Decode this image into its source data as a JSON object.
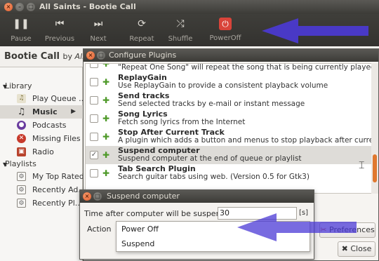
{
  "main_window": {
    "title": "All Saints - Bootie Call",
    "controls": {
      "close": "×",
      "minimize": "–",
      "maximize": "□"
    }
  },
  "toolbar": {
    "pause": {
      "label": "Pause",
      "glyph": "❚❚"
    },
    "previous": {
      "label": "Previous",
      "glyph": "⏮"
    },
    "next": {
      "label": "Next",
      "glyph": "⏭"
    },
    "repeat": {
      "label": "Repeat",
      "glyph": "⟳"
    },
    "shuffle": {
      "label": "Shuffle",
      "glyph": "⤮"
    },
    "poweroff": {
      "label": "PowerOff",
      "glyph": "⏻"
    }
  },
  "now_playing": {
    "title": "Bootie Call",
    "by": "by",
    "artist": "All Sa"
  },
  "sidebar": {
    "library_heading": "Library",
    "library_items": [
      {
        "label": "Play Queue ...",
        "icon": "queue-icon"
      },
      {
        "label": "Music",
        "icon": "music-note-icon",
        "chevron": "▶"
      },
      {
        "label": "Podcasts",
        "icon": "podcast-icon"
      },
      {
        "label": "Missing Files",
        "icon": "missing-files-icon"
      },
      {
        "label": "Radio",
        "icon": "radio-icon"
      }
    ],
    "playlists_heading": "Playlists",
    "playlist_items": [
      {
        "label": "My Top Rated",
        "icon": "smart-playlist-icon"
      },
      {
        "label": "Recently Ad...",
        "icon": "smart-playlist-icon"
      },
      {
        "label": "Recently Pl...",
        "icon": "smart-playlist-icon"
      }
    ]
  },
  "plugins_dialog": {
    "title": "Configure Plugins",
    "plugins": [
      {
        "name": "",
        "description": "\"Repeat One Song\" will repeat the song that is being currently played",
        "checked": false
      },
      {
        "name": "ReplayGain",
        "description": "Use ReplayGain to provide a consistent playback volume",
        "checked": false
      },
      {
        "name": "Send tracks",
        "description": "Send selected tracks by e-mail or instant message",
        "checked": false
      },
      {
        "name": "Song Lyrics",
        "description": "Fetch song lyrics from the Internet",
        "checked": false
      },
      {
        "name": "Stop After Current Track",
        "description": "A plugin which adds a button and menus to stop playback after current track",
        "checked": false
      },
      {
        "name": "Suspend computer",
        "description": "Suspend computer at the end of queue or playlist",
        "checked": true
      },
      {
        "name": "Tab Search Plugin",
        "description": "Search guitar tabs using web. (Version 0.5 for Gtk3)",
        "checked": false
      }
    ],
    "preferences_button": "Preferences",
    "close_button": "Close"
  },
  "suspend_dialog": {
    "title": "Suspend computer",
    "time_label": "Time after computer will be suspended",
    "time_value": "30",
    "time_unit": "[s]",
    "action_label": "Action",
    "action_options": [
      "Power Off",
      "Suspend"
    ]
  },
  "colors": {
    "titlebar": "#3c3b37",
    "toolbar": "#33322f",
    "power_red": "#d9443a",
    "annotation_arrow": "#4b3ad6",
    "plugin_icon_green": "#4f9a2a",
    "scrollbar_orange": "#e0782f"
  }
}
